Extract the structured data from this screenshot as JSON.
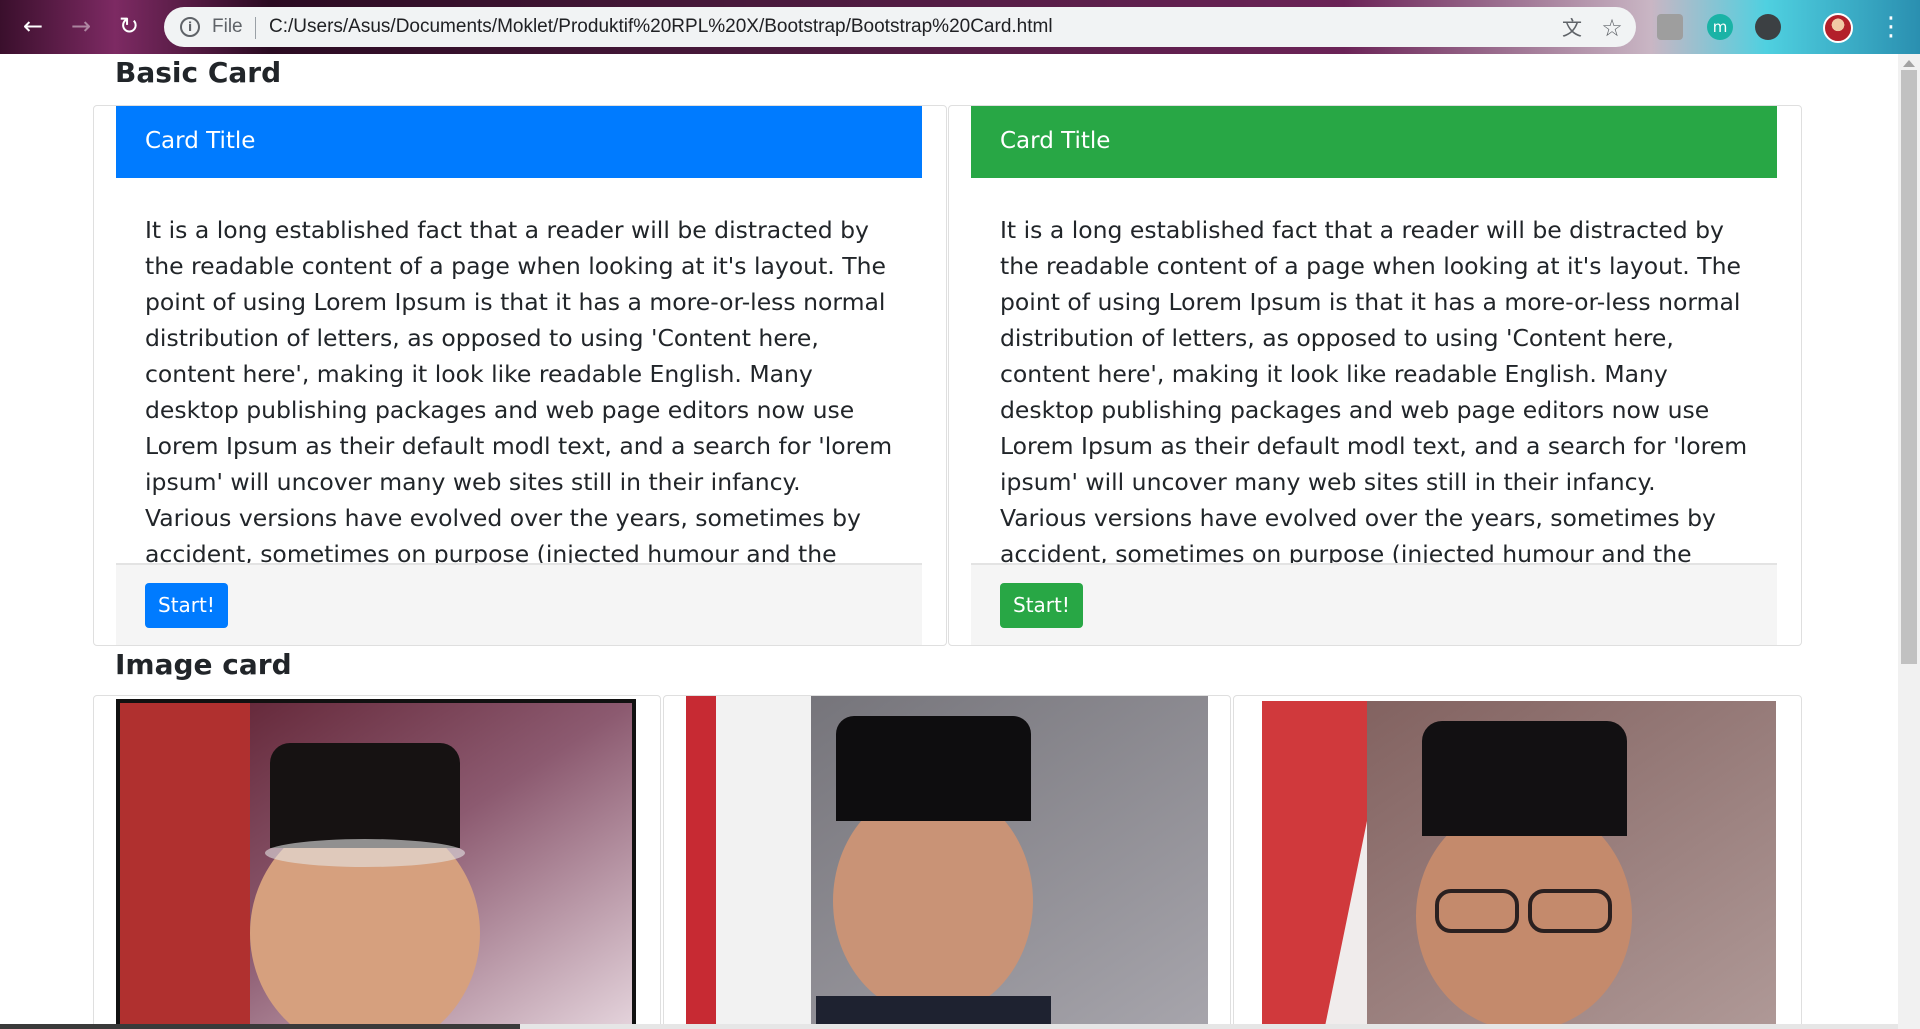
{
  "browser": {
    "url_scheme": "File",
    "url": "C:/Users/Asus/Documents/Moklet/Produktif%20RPL%20X/Bootstrap/Bootstrap%20Card.html",
    "back_icon": "←",
    "forward_icon": "→",
    "reload_icon": "↻",
    "translate_icon": "文",
    "star_icon": "☆",
    "ext_m_label": "m",
    "menu_icon": "⋮"
  },
  "basic_section": {
    "title": "Basic Card",
    "cards": [
      {
        "header": "Card Title",
        "header_color": "#007bff",
        "body": "It is a long established fact that a reader will be distracted by the readable content of a page when looking at it's layout. The point of using Lorem Ipsum is that it has a more-or-less normal distribution of letters, as opposed to using 'Content here, content here', making it look like readable English. Many desktop publishing packages and web page editors now use Lorem Ipsum as their default modl text, and a search for 'lorem ipsum' will uncover many web sites still in their infancy. Various versions have evolved over the years, sometimes by accident, sometimes on purpose (injected humour and the like).",
        "button": "Start!"
      },
      {
        "header": "Card Title",
        "header_color": "#28a745",
        "body": "It is a long established fact that a reader will be distracted by the readable content of a page when looking at it's layout. The point of using Lorem Ipsum is that it has a more-or-less normal distribution of letters, as opposed to using 'Content here, content here', making it look like readable English. Many desktop publishing packages and web page editors now use Lorem Ipsum as their default modl text, and a search for 'lorem ipsum' will uncover many web sites still in their infancy. Various versions have evolved over the years, sometimes by accident, sometimes on purpose (injected humour and the like).",
        "button": "Start!"
      }
    ]
  },
  "image_section": {
    "title": "Image card",
    "images": [
      {
        "subject": "portrait-photo",
        "background": "#7a2a3a"
      },
      {
        "subject": "portrait-photo",
        "background": "#8a8a8e"
      },
      {
        "subject": "portrait-photo",
        "background": "#8a6a66"
      }
    ]
  }
}
